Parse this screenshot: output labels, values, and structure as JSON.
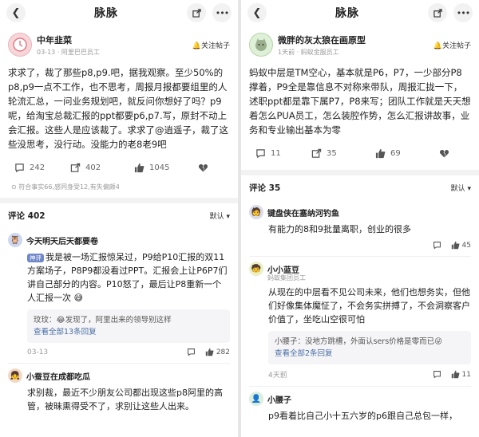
{
  "left": {
    "topbar": {
      "title": "脉脉"
    },
    "post": {
      "author": "中年韭菜",
      "sub": "03-13 · 阿里巴巴员工",
      "follow": "关注帖子",
      "body": "求求了，裁了那些p8,p9.吧，据我观察。至少50%的p8,p9一点不工作，也不思考，周报月报都要组里的人轮流汇总，一问业务规划吧，就反问你想好了吗？p9呢，给淘宝总裁汇报的ppt都要p6,p7.写，原封不动上会汇报。这些人是应该裁了。求求了@逍遥子，裁了这些没思考，没行动。没能力的老8老9吧",
      "comments": "242",
      "shares": "402",
      "likes": "1045",
      "note": "符合事实66,感同身受12,有失偏颇4"
    },
    "comments_head": {
      "label": "评论 402",
      "sort": "默认"
    },
    "comments": [
      {
        "name": "今天明天后天都要卷",
        "tag": "神评",
        "body": "我是被一场汇报惊呆过，P9给P10汇报的双11方案场子，P8P9都没看过PPT。汇报会上让P6P7们讲自己部分的内容。P10怒了，最后让P8重新一个人汇报一次",
        "reply_name": "玟玟：",
        "reply_text": "发现了，阿里出来的领导别这样",
        "reply_more": "查看全部13条回复",
        "date": "03-13",
        "likes": "282"
      },
      {
        "name": "小蚕豆在成都吃瓜",
        "body": "求别裁，最近不少朋友公司都出现这些p8阿里的高管，被昧熏得受不了，求别让这些人出来。"
      }
    ]
  },
  "right": {
    "topbar": {
      "title": "脉脉"
    },
    "post": {
      "author": "微胖的灰太狼在画原型",
      "sub": "1天前 · 蚂蚁金服员工",
      "follow": "关注帖子",
      "body": "蚂蚁中层是TM空心，基本就是P6，P7，一少部分P8撑着，P9全是靠信息不对称来带队，周报汇拢一下，述职ppt都是靠下属P7，P8来写；团队工作就是天天想着怎么PUA员工，怎么装腔作势，怎么汇报讲故事，业务和专业输出基本为零",
      "comments": "11",
      "shares": "35",
      "likes": "69"
    },
    "comments_head": {
      "label": "评论 35",
      "sort": "默认"
    },
    "comments": [
      {
        "name": "键盘侠在塞纳河钓鱼",
        "body": "有能力的8和9批量离职，创业的很多",
        "likes": "45"
      },
      {
        "name": "小小蓝豆",
        "sub": "蚂蚁集团员工",
        "body": "从现在的中层看不见公司未来，他们也想务实，但他们好像集体魔怔了，不会务实拼搏了，不会洞察客户价值了，坐吃山空很可怕",
        "reply_name": "小腰子：",
        "reply_text": "没地方跳槽，外面认sers价格是零而已",
        "reply_more": "查看全部2条回复",
        "date": "4天前",
        "likes": "11"
      },
      {
        "name": "小腰子",
        "body": "p9看着比自己小十五六岁的p6跟自己总包一样，"
      }
    ]
  }
}
